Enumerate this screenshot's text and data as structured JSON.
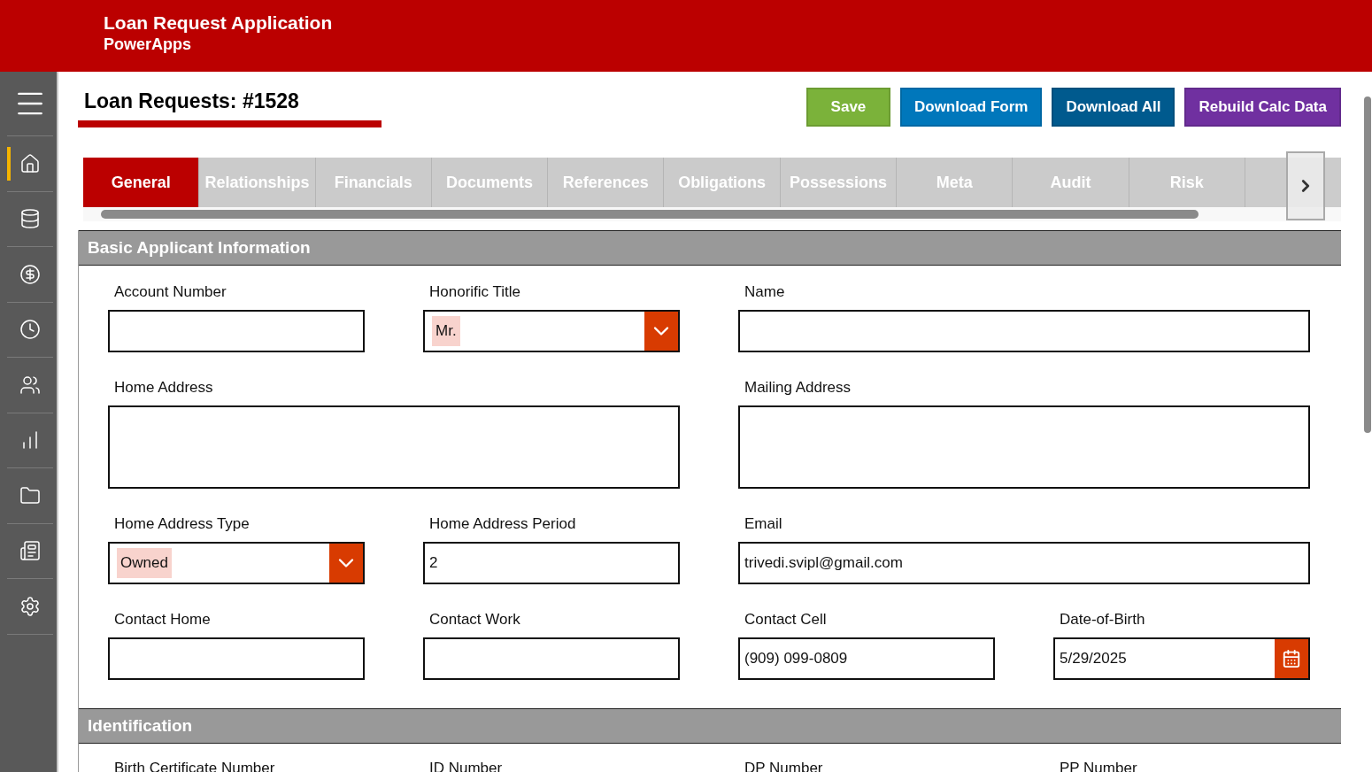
{
  "app_bar": {
    "title": "Loan Request Application",
    "subtitle": "PowerApps"
  },
  "sidebar": {
    "items": [
      {
        "selected": true
      },
      {
        "selected": false
      },
      {
        "selected": false
      },
      {
        "selected": false
      },
      {
        "selected": false
      },
      {
        "selected": false
      },
      {
        "selected": false
      },
      {
        "selected": false
      },
      {
        "selected": false
      }
    ]
  },
  "page_title": "Loan Requests: #1528",
  "actions": [
    {
      "label": "Save",
      "kind": "save"
    },
    {
      "label": "Download Form",
      "kind": "form"
    },
    {
      "label": "Download All",
      "kind": "all"
    },
    {
      "label": "Rebuild Calc Data",
      "kind": "rebuild"
    }
  ],
  "tabs": [
    {
      "label": "General",
      "selected": true
    },
    {
      "label": "Relationships",
      "selected": false
    },
    {
      "label": "Financials",
      "selected": false
    },
    {
      "label": "Documents",
      "selected": false
    },
    {
      "label": "References",
      "selected": false
    },
    {
      "label": "Obligations",
      "selected": false
    },
    {
      "label": "Possessions",
      "selected": false
    },
    {
      "label": "Meta",
      "selected": false
    },
    {
      "label": "Audit",
      "selected": false
    },
    {
      "label": "Risk",
      "selected": false
    }
  ],
  "sections": [
    {
      "title": "Basic Applicant Information",
      "fields": [
        {
          "label": "Account Number",
          "kind": "text",
          "wide": false
        },
        {
          "label": "Honorific Title",
          "kind": "dropdown",
          "value": "Mr.",
          "wide": false
        },
        {
          "label": "Name",
          "kind": "text",
          "wide": true
        },
        {
          "label": "Home Address",
          "kind": "textarea",
          "wide": true
        },
        {
          "label": "Mailing Address",
          "kind": "textarea",
          "wide": true
        },
        {
          "label": "Home Address Type",
          "kind": "dropdown",
          "value": "Owned",
          "wide": false
        },
        {
          "label": "Home Address Period",
          "kind": "text",
          "value": "2",
          "wide": false
        },
        {
          "label": "Email",
          "kind": "text",
          "value": "trivedi.svipl@gmail.com",
          "wide": true
        },
        {
          "label": "Contact Home",
          "kind": "text",
          "wide": false
        },
        {
          "label": "Contact Work",
          "kind": "text",
          "wide": false
        },
        {
          "label": "Contact Cell",
          "kind": "text",
          "value": "(909) 099-0809",
          "wide": false
        },
        {
          "label": "Date-of-Birth",
          "kind": "date",
          "value": "5/29/2025",
          "wide": false
        }
      ]
    },
    {
      "title": "Identification",
      "fields": [
        {
          "label": "Birth Certificate Number",
          "kind": "label",
          "wide": false
        },
        {
          "label": "ID Number",
          "kind": "label",
          "wide": false
        },
        {
          "label": "DP Number",
          "kind": "label",
          "wide": false
        },
        {
          "label": "PP Number",
          "kind": "label",
          "wide": false
        }
      ]
    }
  ]
}
